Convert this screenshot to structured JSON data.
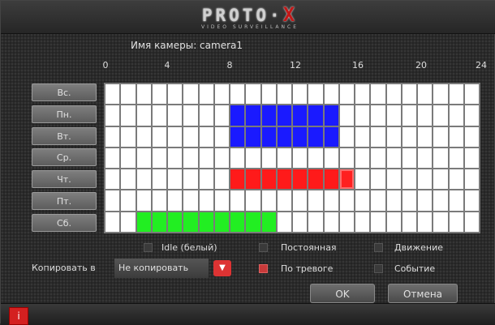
{
  "logo": {
    "main": "PROTO",
    "dot": "·",
    "x": "X",
    "sub": "VIDEO SURVEILLANCE"
  },
  "camera_name": "Имя камеры: camera1",
  "hours": [
    "0",
    "4",
    "8",
    "12",
    "16",
    "20",
    "24"
  ],
  "days": [
    "Вс.",
    "Пн.",
    "Вт.",
    "Ср.",
    "Чт.",
    "Пт.",
    "Сб."
  ],
  "schedule": {
    "colors": {
      "idle": "#ffffff",
      "continuous": "#1a1aff",
      "alarm": "#ff1a1a",
      "motion": "#22ee22"
    },
    "rows": [
      {
        "day": "Вс.",
        "segments": []
      },
      {
        "day": "Пн.",
        "segments": [
          {
            "type": "continuous",
            "start": 8,
            "end": 15
          }
        ]
      },
      {
        "day": "Вт.",
        "segments": [
          {
            "type": "continuous",
            "start": 8,
            "end": 15
          }
        ]
      },
      {
        "day": "Ср.",
        "segments": []
      },
      {
        "day": "Чт.",
        "segments": [
          {
            "type": "alarm",
            "start": 8,
            "end": 16
          }
        ]
      },
      {
        "day": "Пт.",
        "segments": []
      },
      {
        "day": "Сб.",
        "segments": [
          {
            "type": "motion",
            "start": 2,
            "end": 11
          }
        ]
      }
    ]
  },
  "legend": {
    "idle": "Idle (белый)",
    "continuous": "Постоянная",
    "motion": "Движение",
    "alarm": "По тревоге",
    "event": "Событие"
  },
  "copy": {
    "label": "Копировать в",
    "value": "Не копировать"
  },
  "buttons": {
    "ok": "OK",
    "cancel": "Отмена"
  },
  "status": {
    "info_icon": "i"
  }
}
